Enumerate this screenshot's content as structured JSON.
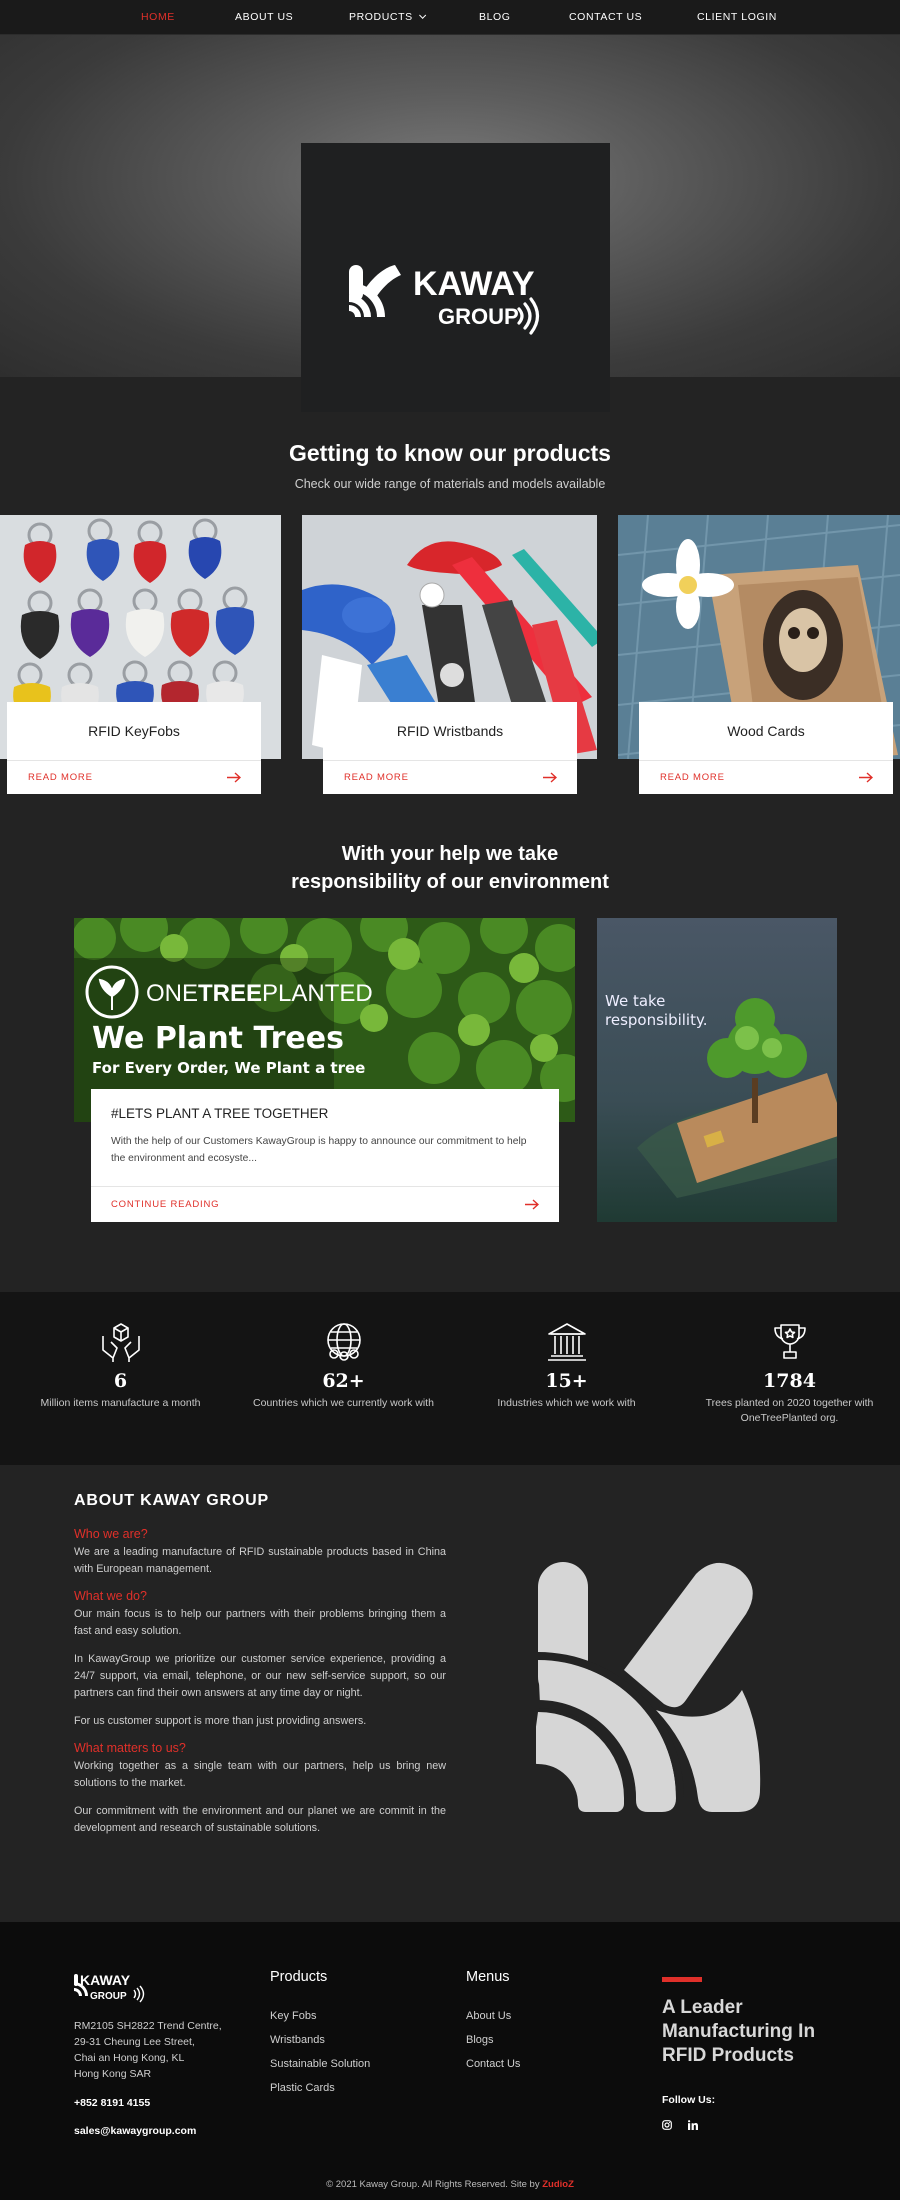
{
  "nav": {
    "items": [
      {
        "label": "HOME"
      },
      {
        "label": "ABOUT US"
      },
      {
        "label": "PRODUCTS"
      },
      {
        "label": "BLOG"
      },
      {
        "label": "CONTACT US"
      },
      {
        "label": "CLIENT LOGIN"
      }
    ]
  },
  "hero": {
    "logo_name": "KAWAY",
    "logo_sub": "GROUP"
  },
  "products": {
    "title": "Getting to know our products",
    "subtitle": "Check our wide range of materials and models available",
    "cards": [
      {
        "title": "RFID KeyFobs",
        "link": "READ MORE"
      },
      {
        "title": "RFID Wristbands",
        "link": "READ MORE"
      },
      {
        "title": "Wood Cards",
        "link": "READ MORE"
      }
    ]
  },
  "environment": {
    "title_line1": "With your help we take",
    "title_line2": "responsibility of our environment",
    "banner": {
      "brand_pre": "ONE",
      "brand_mid": "TREE",
      "brand_post": "PLANTED",
      "headline": "We Plant Trees",
      "tagline": "For Every Order, We Plant a tree"
    },
    "post": {
      "title": "#LETS PLANT A TREE TOGETHER",
      "excerpt": "With the help of our Customers KawayGroup is happy to announce our commitment to help the environment and ecosyste...",
      "link": "CONTINUE READING"
    },
    "side_text_1": "We take",
    "side_text_2": "responsibility."
  },
  "stats": [
    {
      "value": "6",
      "label": "Million items manufacture a month",
      "icon": "hands-box-icon"
    },
    {
      "value": "62+",
      "label": "Countries which we currently work with",
      "icon": "globe-icon"
    },
    {
      "value": "15+",
      "label": "Industries which we work with",
      "icon": "building-icon"
    },
    {
      "value": "1784",
      "label": "Trees planted on 2020 together with OneTreePlanted org.",
      "icon": "trophy-icon"
    }
  ],
  "about": {
    "title": "ABOUT KAWAY GROUP",
    "q1": "Who we are?",
    "p1": "We are a leading manufacture of RFID sustainable products based in China with European management.",
    "q2": "What we do?",
    "p2": "Our main focus is to help our partners with their problems bringing them a fast and easy solution.",
    "p3": "In KawayGroup we prioritize our customer service experience, providing a 24/7 support, via email, telephone, or our new self-service support, so our partners can find their own answers at any time day or night.",
    "p4": "For us customer support is more than just providing answers.",
    "q3": "What matters to us?",
    "p5": "Working together as a single team with our partners, help us bring new solutions to the market.",
    "p6": "Our commitment with the environment and our planet we are commit in the development and research of sustainable solutions."
  },
  "footer": {
    "address1": "RM2105 SH2822 Trend Centre,",
    "address2": "29-31 Cheung Lee Street,",
    "address3": "Chai an Hong Kong, KL",
    "address4": "Hong Kong SAR",
    "phone": "+852 8191 4155",
    "email": "sales@kawaygroup.com",
    "products_title": "Products",
    "products": [
      "Key Fobs",
      "Wristbands",
      "Sustainable Solution",
      "Plastic Cards"
    ],
    "menus_title": "Menus",
    "menus": [
      "About Us",
      "Blogs",
      "Contact Us"
    ],
    "slogan1": "A Leader",
    "slogan2": "Manufacturing In",
    "slogan3": "RFID Products",
    "follow": "Follow Us:",
    "copyright": "© 2021 Kaway Group. All Rights Reserved. Site by ",
    "credit": "ZudioZ"
  },
  "colors": {
    "accent": "#e0302a",
    "background": "#232323",
    "footer": "#0c0c0c"
  }
}
